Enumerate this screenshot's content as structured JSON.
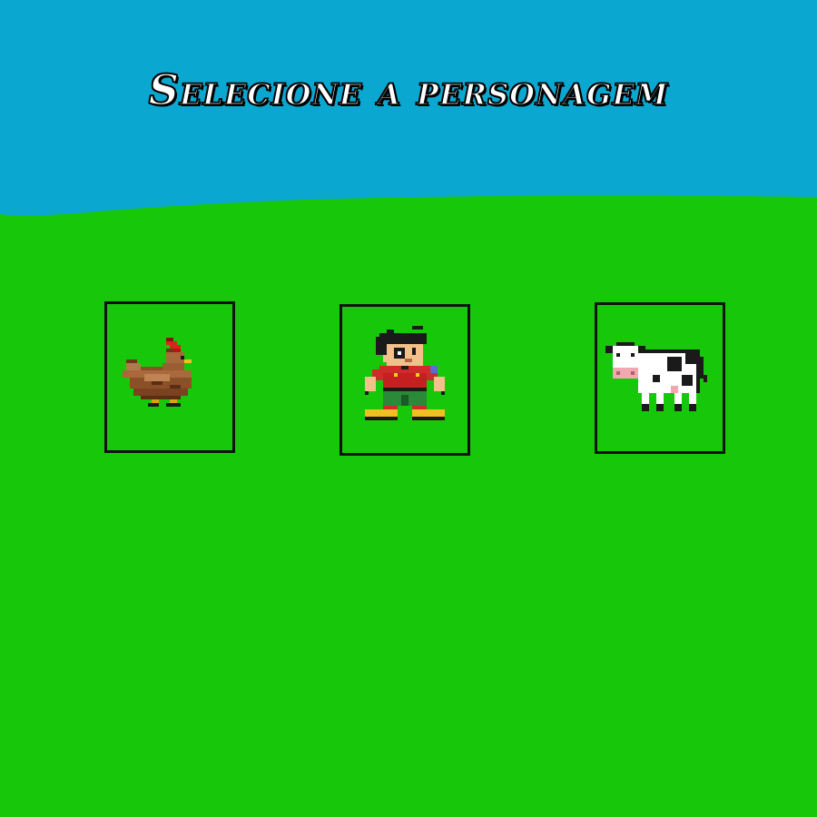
{
  "screen": {
    "title": "Selecione a personagem"
  },
  "colors": {
    "sky": "#0aa8d0",
    "grass": "#17c80a",
    "frame": "#111111",
    "title_fill": "#ffffff",
    "title_outline": "#000000"
  },
  "characters": [
    {
      "id": "chicken",
      "icon": "chicken-sprite-icon"
    },
    {
      "id": "player",
      "icon": "boy-player-sprite-icon"
    },
    {
      "id": "cow",
      "icon": "cow-sprite-icon"
    }
  ]
}
